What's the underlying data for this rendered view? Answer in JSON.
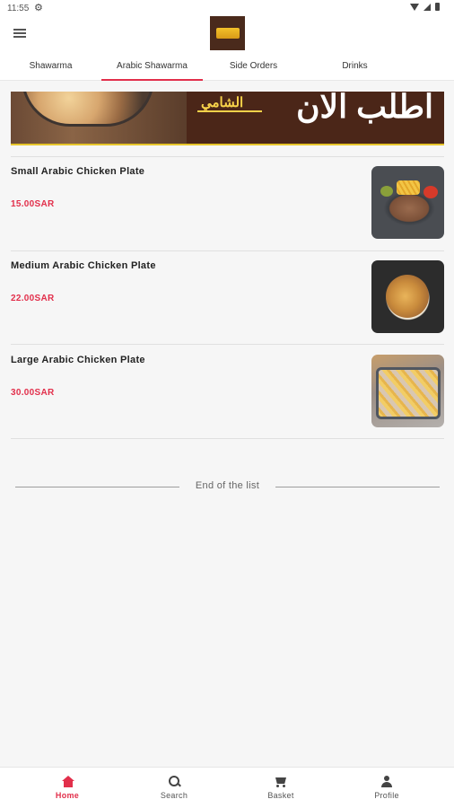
{
  "status_bar": {
    "time": "11:55",
    "gear_icon": "gear-icon",
    "icons": [
      "wifi-icon",
      "signal-icon",
      "battery-icon"
    ]
  },
  "header": {
    "menu_icon": "menu-icon",
    "logo_icon": "brand-logo"
  },
  "tabs": [
    {
      "label": "Shawarma",
      "active": false
    },
    {
      "label": "Arabic Shawarma",
      "active": true
    },
    {
      "label": "Side Orders",
      "active": false
    },
    {
      "label": "Drinks",
      "active": false
    }
  ],
  "banner": {
    "brand": "الشامي",
    "headline": "اطلب الان"
  },
  "items": [
    {
      "name": "Small  Arabic Chicken Plate",
      "price": "15.00SAR"
    },
    {
      "name": "Medium Arabic Chicken Plate",
      "price": "22.00SAR"
    },
    {
      "name": "Large Arabic Chicken Plate",
      "price": "30.00SAR"
    }
  ],
  "list_end": {
    "text": "End of the list"
  },
  "bottom_nav": [
    {
      "label": "Home",
      "icon": "home-icon",
      "active": true
    },
    {
      "label": "Search",
      "icon": "search-icon",
      "active": false
    },
    {
      "label": "Basket",
      "icon": "basket-icon",
      "active": false
    },
    {
      "label": "Profile",
      "icon": "profile-icon",
      "active": false
    }
  ],
  "colors": {
    "accent": "#e22f4b",
    "brand_brown": "#4b2618",
    "brand_gold": "#f7d24a"
  }
}
